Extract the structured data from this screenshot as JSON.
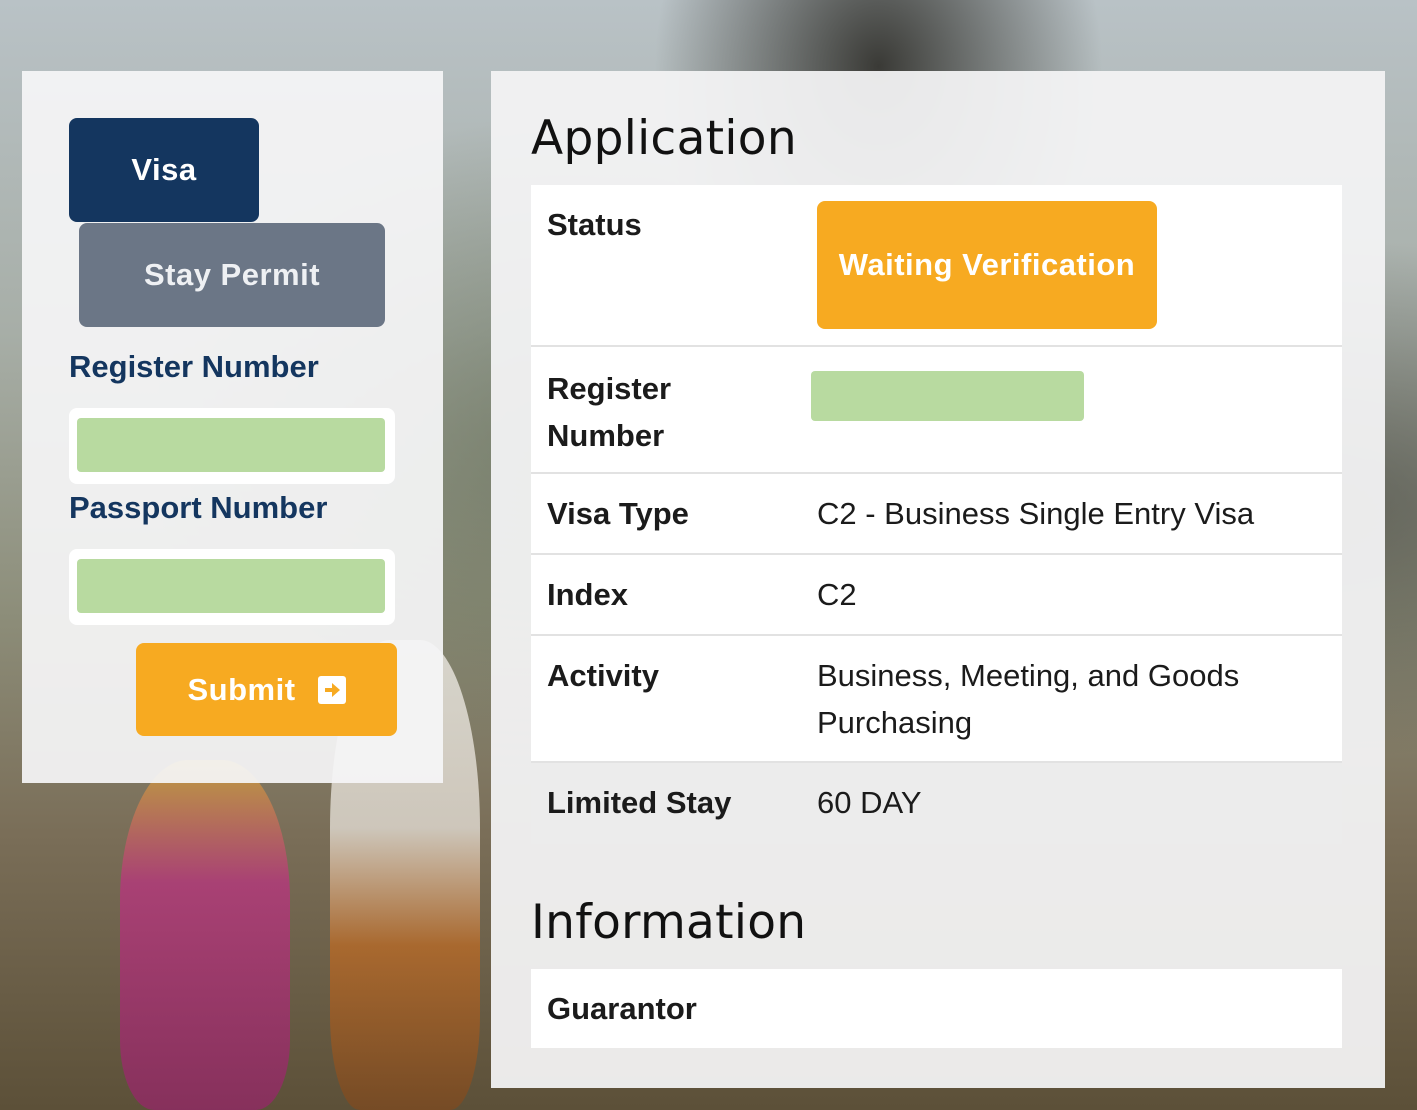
{
  "left_panel": {
    "tabs": [
      {
        "label": "Visa",
        "active": true
      },
      {
        "label": "Stay Permit",
        "active": false
      }
    ],
    "register_number": {
      "label": "Register Number",
      "value": "",
      "placeholder": ""
    },
    "passport_number": {
      "label": "Passport Number",
      "value": "",
      "placeholder": ""
    },
    "submit": {
      "label": "Submit",
      "icon": "sign-in-icon"
    }
  },
  "application": {
    "title": "Application",
    "status": {
      "label": "Status",
      "value": "Waiting Verification"
    },
    "register_number": {
      "label": "Register Number",
      "value": ""
    },
    "visa_type": {
      "label": "Visa Type",
      "value": "C2 - Business Single Entry Visa"
    },
    "index": {
      "label": "Index",
      "value": "C2"
    },
    "activity": {
      "label": "Activity",
      "value": "Business, Meeting, and Goods Purchasing"
    },
    "limited_stay": {
      "label": "Limited Stay",
      "value": "60 DAY"
    }
  },
  "information": {
    "title": "Information",
    "guarantor": {
      "label": "Guarantor",
      "value": ""
    }
  },
  "colors": {
    "primary_navy": "#14365f",
    "inactive_gray": "#6b7686",
    "accent_orange": "#f7aa21",
    "redacted_green": "#b8daa0"
  }
}
